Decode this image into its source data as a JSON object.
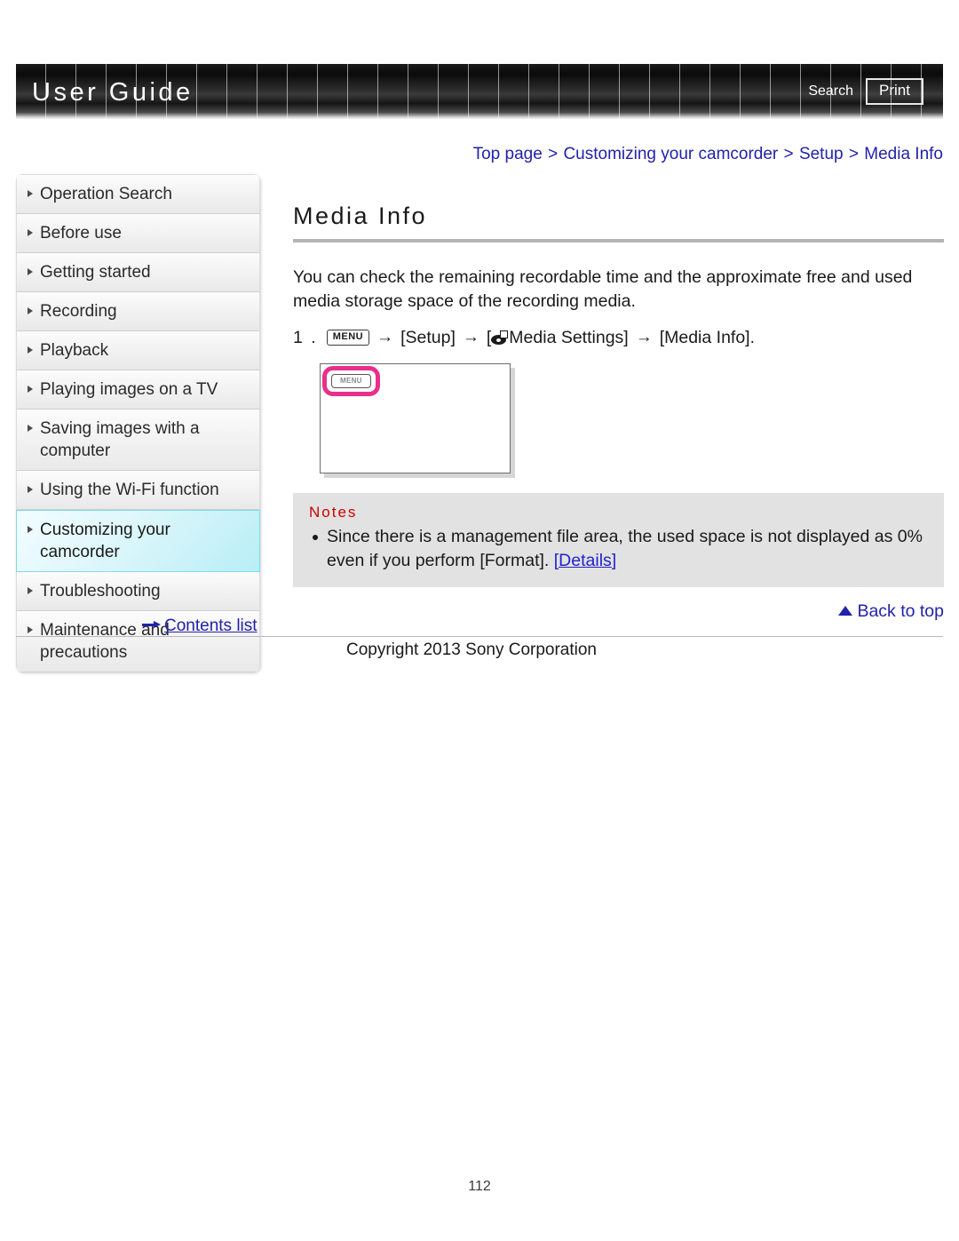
{
  "header": {
    "title": "User Guide",
    "search_label": "Search",
    "print_label": "Print"
  },
  "breadcrumb": {
    "separator": ">",
    "items": [
      {
        "label": "Top page"
      },
      {
        "label": "Customizing your camcorder"
      },
      {
        "label": "Setup"
      },
      {
        "label": "Media Info"
      }
    ]
  },
  "sidebar": {
    "items": [
      {
        "label": "Operation Search",
        "active": false
      },
      {
        "label": "Before use",
        "active": false
      },
      {
        "label": "Getting started",
        "active": false
      },
      {
        "label": "Recording",
        "active": false
      },
      {
        "label": "Playback",
        "active": false
      },
      {
        "label": "Playing images on a TV",
        "active": false
      },
      {
        "label": "Saving images with a computer",
        "active": false
      },
      {
        "label": "Using the Wi-Fi function",
        "active": false
      },
      {
        "label": "Customizing your camcorder",
        "active": true
      },
      {
        "label": "Troubleshooting",
        "active": false
      },
      {
        "label": "Maintenance and precautions",
        "active": false
      }
    ],
    "contents_link": "Contents list",
    "highlight_color": "#b8eef6",
    "highlight_border_color": "#7fdbe8"
  },
  "main": {
    "page_title": "Media Info",
    "intro": "You can check the remaining recordable time and the approximate free and used media storage space of the recording media.",
    "step": {
      "number": "1 .",
      "menu_chip": "MENU",
      "arrow": "→",
      "part_setup": "[Setup]",
      "part_media_settings_open": "[",
      "part_media_settings": "Media Settings]",
      "part_media_info": "[Media Info]."
    },
    "figure": {
      "menu_chip": "MENU",
      "highlight_color": "#e8308a"
    },
    "notes": {
      "title": "Notes",
      "bullet_text_before_link": "Since there is a management file area, the used space is not displayed as 0% even if you perform [Format].",
      "link_label": "[Details]"
    },
    "back_to_top": "Back to top"
  },
  "footer": {
    "copyright": "Copyright 2013 Sony Corporation",
    "page_number": "112"
  }
}
